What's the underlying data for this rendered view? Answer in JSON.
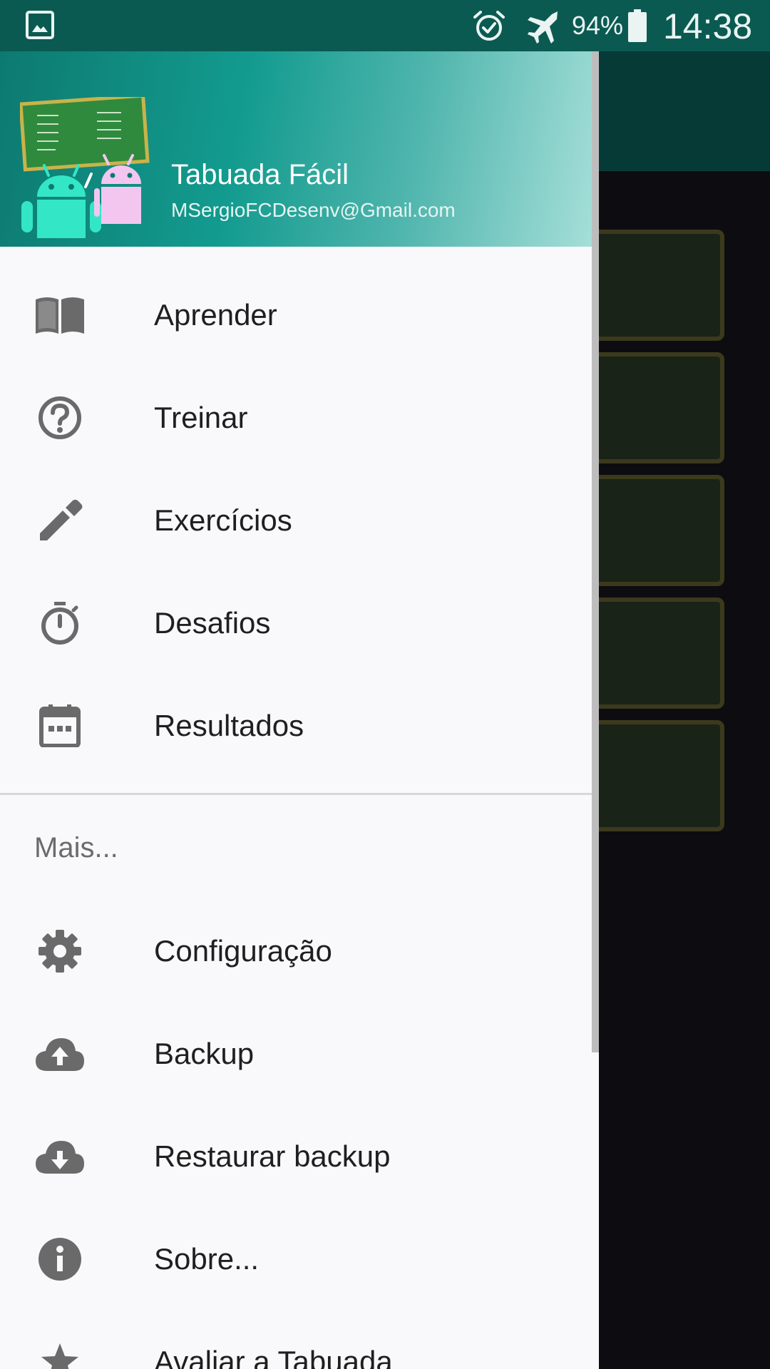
{
  "status_bar": {
    "battery_percent": "94%",
    "time": "14:38"
  },
  "drawer": {
    "header": {
      "app_name": "Tabuada Fácil",
      "email": "MSergioFCDesenv@Gmail.com"
    },
    "primary_items": [
      {
        "label": "Aprender",
        "icon": "book-icon"
      },
      {
        "label": "Treinar",
        "icon": "help-circle-icon"
      },
      {
        "label": "Exercícios",
        "icon": "pencil-icon"
      },
      {
        "label": "Desafios",
        "icon": "timer-icon"
      },
      {
        "label": "Resultados",
        "icon": "calendar-icon"
      }
    ],
    "section_title": "Mais...",
    "secondary_items": [
      {
        "label": "Configuração",
        "icon": "gear-icon"
      },
      {
        "label": "Backup",
        "icon": "cloud-upload-icon"
      },
      {
        "label": "Restaurar backup",
        "icon": "cloud-download-icon"
      },
      {
        "label": "Sobre...",
        "icon": "info-icon"
      },
      {
        "label": "Avaliar a Tabuada",
        "icon": "star-icon"
      }
    ]
  },
  "colors": {
    "header_teal": "#139b8f",
    "status_bar": "#0b5a52",
    "drawer_bg": "#f9f8fb",
    "icon_gray": "#6a6a6a"
  }
}
